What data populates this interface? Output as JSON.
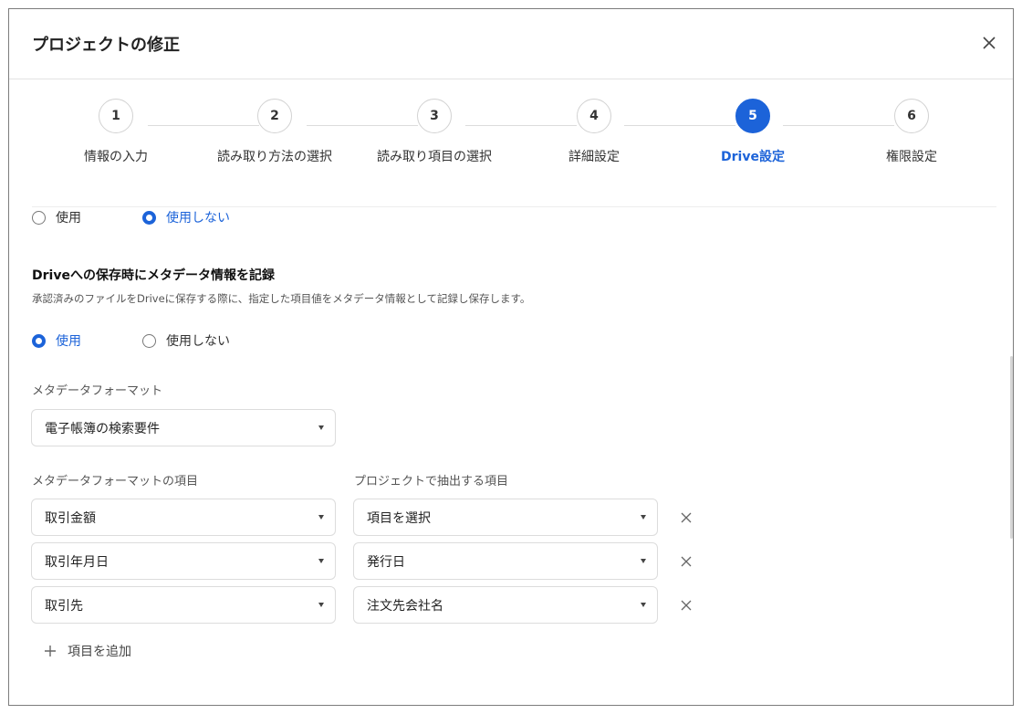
{
  "modal": {
    "title": "プロジェクトの修正"
  },
  "steps": [
    {
      "number": "1",
      "label": "情報の入力"
    },
    {
      "number": "2",
      "label": "読み取り方法の選択"
    },
    {
      "number": "3",
      "label": "読み取り項目の選択"
    },
    {
      "number": "4",
      "label": "詳細設定"
    },
    {
      "number": "5",
      "label": "Drive設定",
      "active": true
    },
    {
      "number": "6",
      "label": "権限設定"
    }
  ],
  "top_radio": {
    "option_use": "使用",
    "option_not_use": "使用しない",
    "selected": "使用しない"
  },
  "metadata": {
    "title": "Driveへの保存時にメタデータ情報を記録",
    "description": "承認済みのファイルをDriveに保存する際に、指定した項目値をメタデータ情報として記録し保存します。",
    "radio": {
      "option_use": "使用",
      "option_not_use": "使用しない",
      "selected": "使用"
    },
    "format_label": "メタデータフォーマット",
    "format_value": "電子帳簿の検索要件",
    "column_format_items": "メタデータフォーマットの項目",
    "column_project_items": "プロジェクトで抽出する項目",
    "mappings": [
      {
        "format_item": "取引金額",
        "project_item": "項目を選択"
      },
      {
        "format_item": "取引年月日",
        "project_item": "発行日"
      },
      {
        "format_item": "取引先",
        "project_item": "注文先会社名"
      }
    ],
    "add_item_label": "項目を追加"
  },
  "colors": {
    "accent": "#1c63d9",
    "border": "#dcdcdc"
  }
}
